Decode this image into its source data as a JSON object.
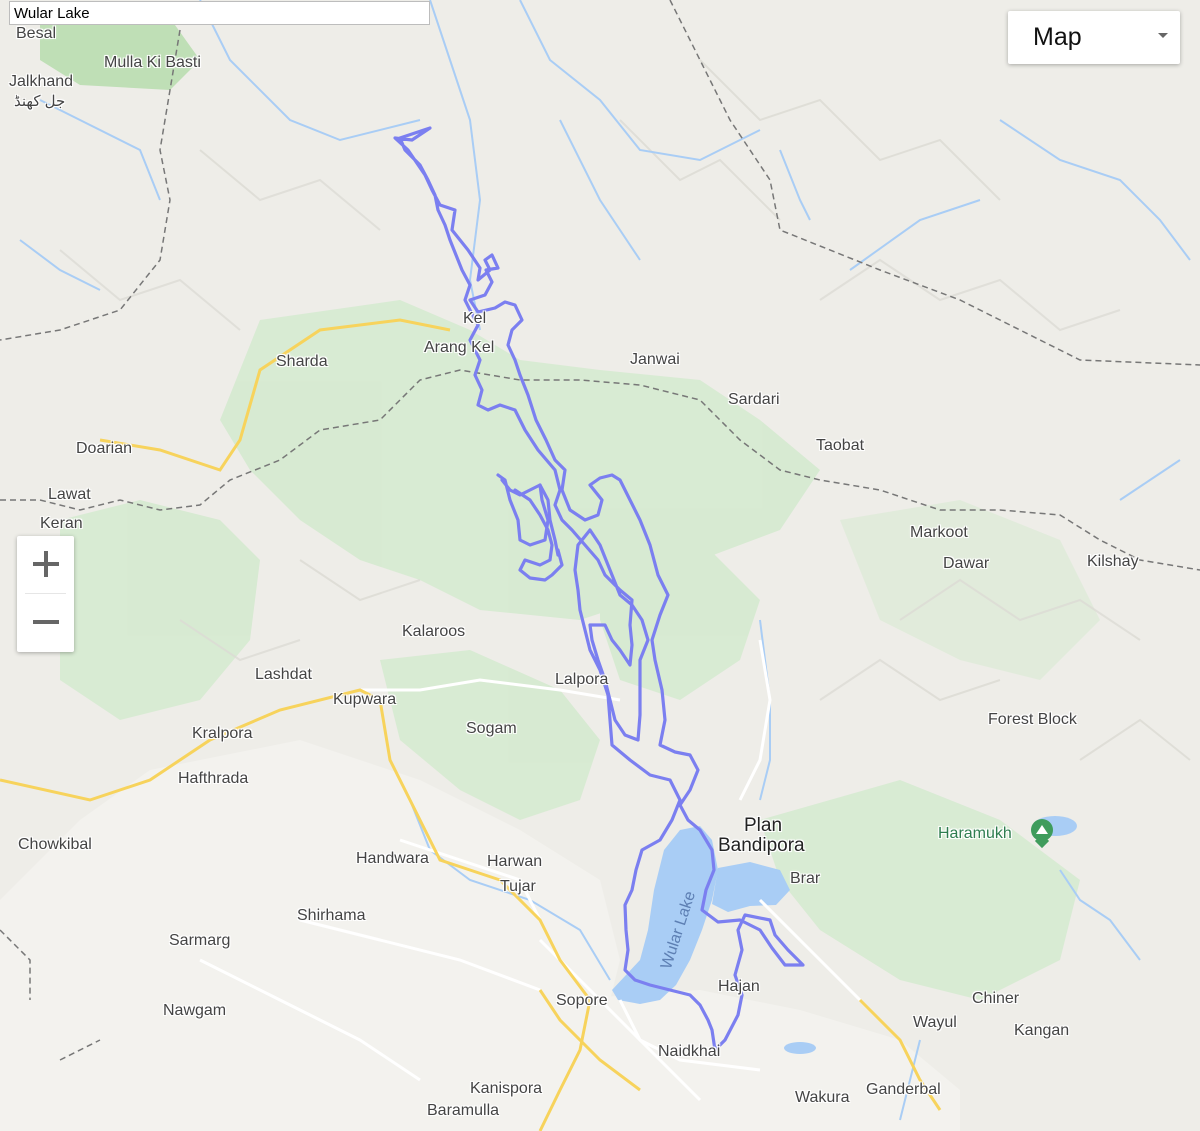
{
  "search": {
    "value": "Wular Lake"
  },
  "map_type": {
    "selected": "Map"
  },
  "zoom": {
    "in_label": "+",
    "out_label": "−"
  },
  "colors": {
    "route": "#7b7ff0",
    "water": "#a9cdf5",
    "road_major": "#f7d35c",
    "forest": "#d3ebcf",
    "border": "#777777"
  },
  "icons": {
    "peak": "mountain-peak-icon"
  },
  "lake_label": "Wular Lake",
  "places": [
    {
      "name": "Besal"
    },
    {
      "name": "Mulla Ki Basti"
    },
    {
      "name": "Jalkhand"
    },
    {
      "name": "جل کھنڈ"
    },
    {
      "name": "Kel"
    },
    {
      "name": "Arang Kel"
    },
    {
      "name": "Sharda"
    },
    {
      "name": "Janwai"
    },
    {
      "name": "Sardari"
    },
    {
      "name": "Taobat"
    },
    {
      "name": "Doarian"
    },
    {
      "name": "Lawat"
    },
    {
      "name": "Keran"
    },
    {
      "name": "Markoot"
    },
    {
      "name": "Dawar"
    },
    {
      "name": "Kilshay"
    },
    {
      "name": "Kalaroos"
    },
    {
      "name": "Lashdat"
    },
    {
      "name": "Lalpora"
    },
    {
      "name": "Kupwara"
    },
    {
      "name": "Kralpora"
    },
    {
      "name": "Sogam"
    },
    {
      "name": "Forest Block"
    },
    {
      "name": "Hafthrada"
    },
    {
      "name": "Chowkibal"
    },
    {
      "name": "Plan"
    },
    {
      "name": "Bandipora"
    },
    {
      "name": "Haramukh"
    },
    {
      "name": "Handwara"
    },
    {
      "name": "Harwan"
    },
    {
      "name": "Tujar"
    },
    {
      "name": "Brar"
    },
    {
      "name": "Shirhama"
    },
    {
      "name": "Sarmarg"
    },
    {
      "name": "Hajan"
    },
    {
      "name": "Sopore"
    },
    {
      "name": "Chiner"
    },
    {
      "name": "Wayul"
    },
    {
      "name": "Kangan"
    },
    {
      "name": "Nawgam"
    },
    {
      "name": "Naidkhai"
    },
    {
      "name": "Kanispora"
    },
    {
      "name": "Wakura"
    },
    {
      "name": "Ganderbal"
    },
    {
      "name": "Baramulla"
    }
  ]
}
